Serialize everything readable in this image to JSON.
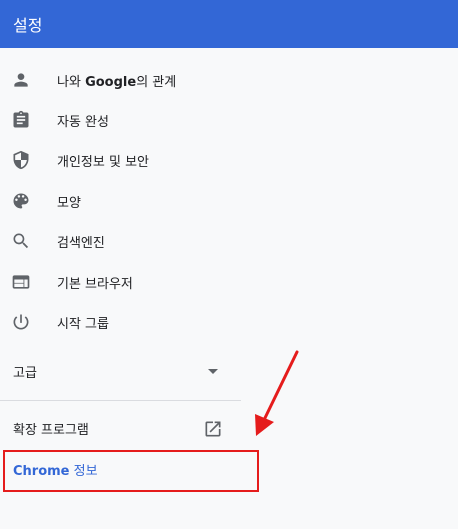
{
  "header": {
    "title": "설정"
  },
  "menu": {
    "items": [
      {
        "label_pre": "나와 ",
        "label_bold": "Google",
        "label_post": "의 관계",
        "icon": "person-icon"
      },
      {
        "label": "자동 완성",
        "icon": "clipboard-icon"
      },
      {
        "label": "개인정보 및 보안",
        "icon": "shield-icon"
      },
      {
        "label": "모양",
        "icon": "palette-icon"
      },
      {
        "label": "검색엔진",
        "icon": "search-icon"
      },
      {
        "label": "기본 브라우저",
        "icon": "browser-icon"
      },
      {
        "label": "시작 그룹",
        "icon": "power-icon"
      }
    ]
  },
  "advanced": {
    "label": "고급"
  },
  "extensions": {
    "label": "확장 프로그램",
    "icon": "open-in-new-icon"
  },
  "about": {
    "label_bold": "Chrome",
    "label_post": " 정보"
  },
  "colors": {
    "header": "#3367d6",
    "annotation": "#e51c1c",
    "link": "#3367d6"
  }
}
